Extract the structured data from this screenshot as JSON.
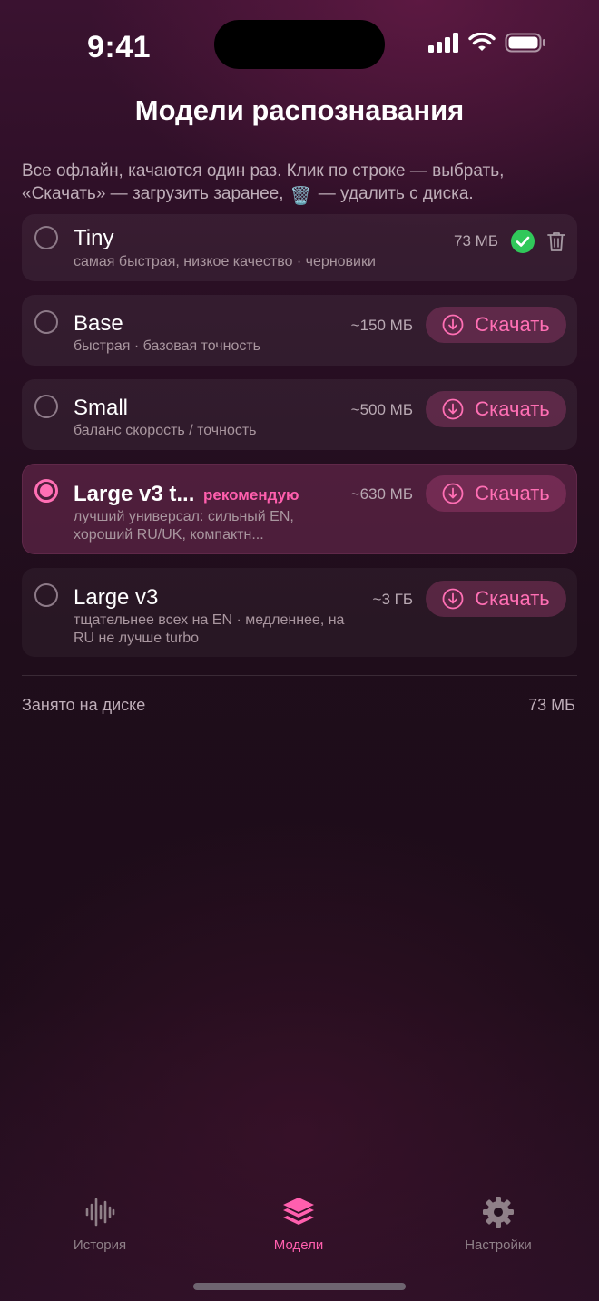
{
  "status_bar": {
    "time": "9:41"
  },
  "header": {
    "title": "Модели распознавания"
  },
  "intro": {
    "text_before": "Все офлайн, качаются один раз. Клик по строке — выбрать, «Скачать» — загрузить заранее,",
    "trash_emoji": "🗑️",
    "text_after": "— удалить с диска."
  },
  "models": [
    {
      "name": "Tiny",
      "desc": "самая быстрая, низкое качество · черновики",
      "size": "73 МБ",
      "state": "downloaded",
      "selected": false
    },
    {
      "name": "Base",
      "desc": "быстрая · базовая точность",
      "size": "~150 МБ",
      "action": "Скачать",
      "selected": false
    },
    {
      "name": "Small",
      "desc": "баланс скорость / точность",
      "size": "~500 МБ",
      "action": "Скачать",
      "selected": false
    },
    {
      "name": "Large v3 t...",
      "badge": "рекомендую",
      "desc": "лучший универсал: сильный EN, хороший RU/UK, компактн...",
      "size": "~630 МБ",
      "action": "Скачать",
      "selected": true
    },
    {
      "name": "Large v3",
      "desc": "тщательнее всех на EN · медленнее, на RU не лучше turbo",
      "size": "~3 ГБ",
      "action": "Скачать",
      "selected": false
    }
  ],
  "disk": {
    "label": "Занято на диске",
    "value": "73 МБ"
  },
  "tabs": [
    {
      "label": "История",
      "icon": "waveform-icon",
      "active": false
    },
    {
      "label": "Модели",
      "icon": "layers-icon",
      "active": true
    },
    {
      "label": "Настройки",
      "icon": "gear-icon",
      "active": false
    }
  ],
  "colors": {
    "accent": "#ff5fae",
    "success": "#30c85a",
    "background": "#1f0d1b"
  }
}
